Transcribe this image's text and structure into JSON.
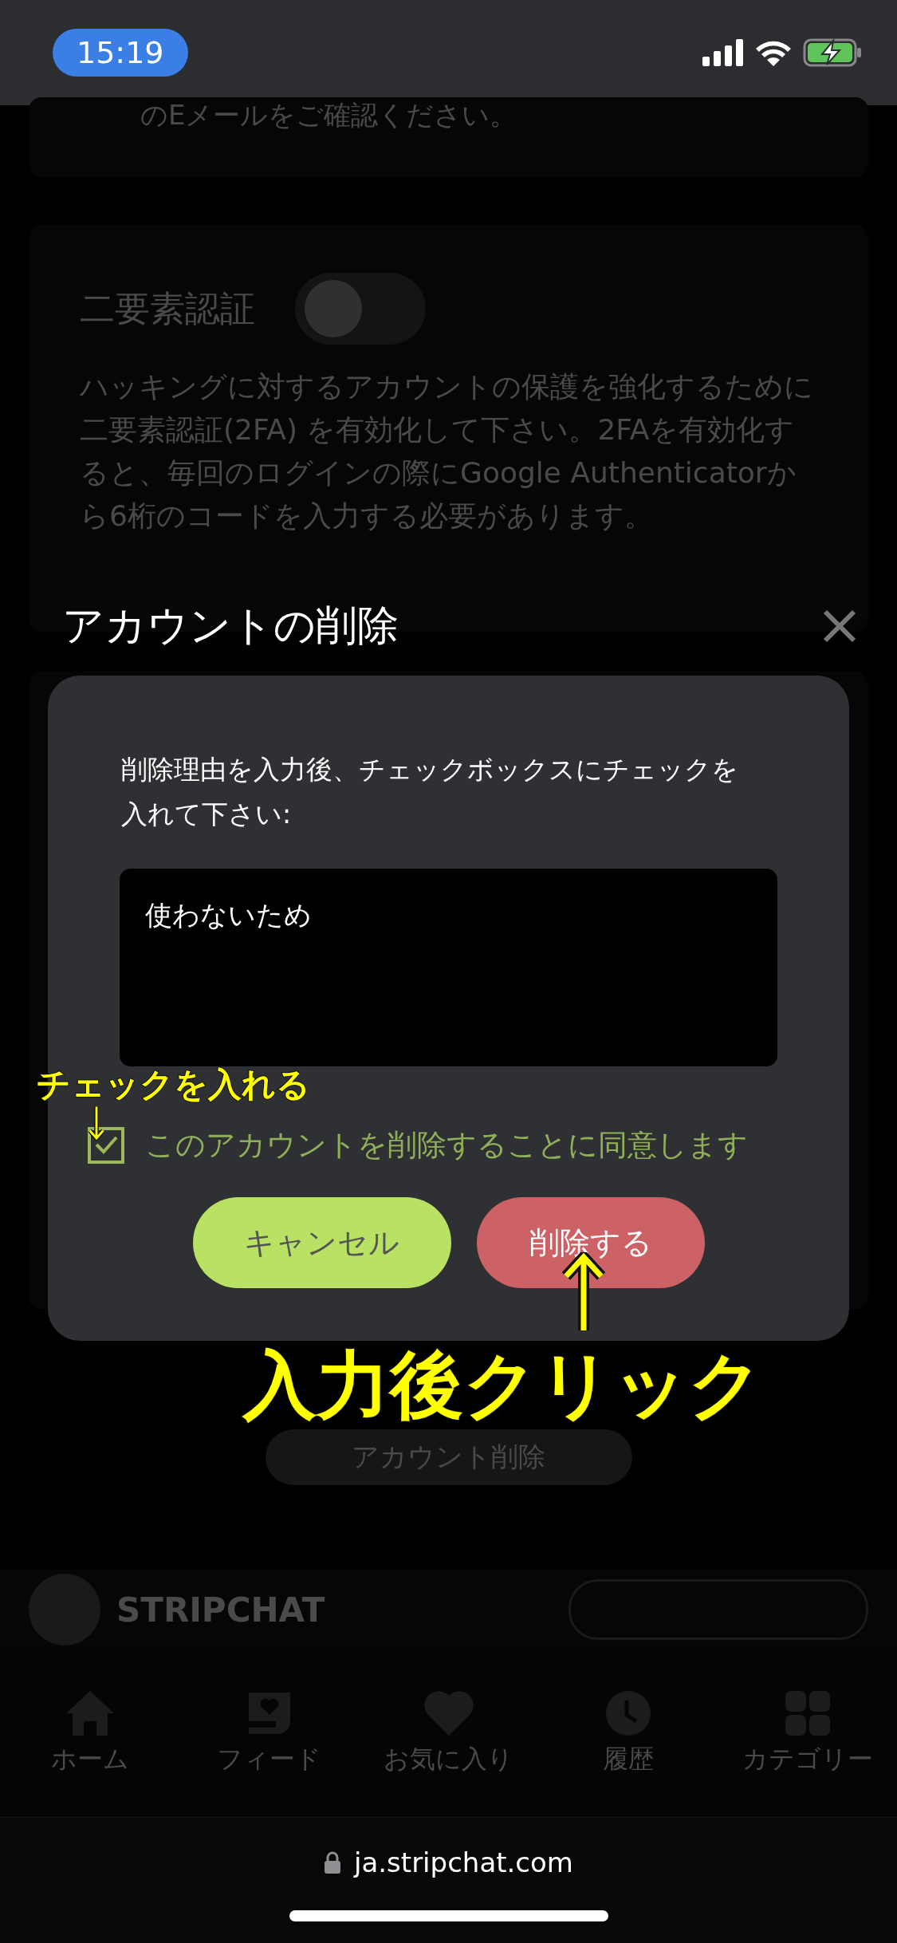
{
  "status_bar": {
    "time": "15:19"
  },
  "background": {
    "email_note": "のEメールをご確認ください。",
    "two_factor": {
      "title": "二要素認証",
      "on": false,
      "description": "ハッキングに対するアカウントの保護を強化するために二要素認証(2FA) を有効化して下さい。2FAを有効化すると、毎回のログインの際にGoogle Authenticatorから6桁のコードを入力する必要があります。"
    },
    "delete_account_button": "アカウント削除",
    "footer": {
      "logo": "STRIPCHAT"
    }
  },
  "dialog": {
    "title": "アカウントの削除",
    "instruction": "削除理由を入力後、チェックボックスにチェックを入れて下さい:",
    "reason": {
      "value": "使わないため"
    },
    "agree": {
      "label": "このアカウントを削除することに同意します",
      "checked": true
    },
    "buttons": [
      {
        "label": "キャンセル",
        "kind": "cancel"
      },
      {
        "label": "削除する",
        "kind": "delete"
      }
    ]
  },
  "annotations": [
    {
      "text": "チェックを入れる",
      "kind": "small"
    },
    {
      "text": "入力後クリック",
      "kind": "large"
    }
  ],
  "nav": [
    {
      "label": "ホーム",
      "kind": "home"
    },
    {
      "label": "フィード",
      "kind": "feed"
    },
    {
      "label": "お気に入り",
      "kind": "favorites"
    },
    {
      "label": "履歴",
      "kind": "history"
    },
    {
      "label": "カテゴリー",
      "kind": "categories"
    }
  ],
  "browser": {
    "url": "ja.stripchat.com"
  }
}
